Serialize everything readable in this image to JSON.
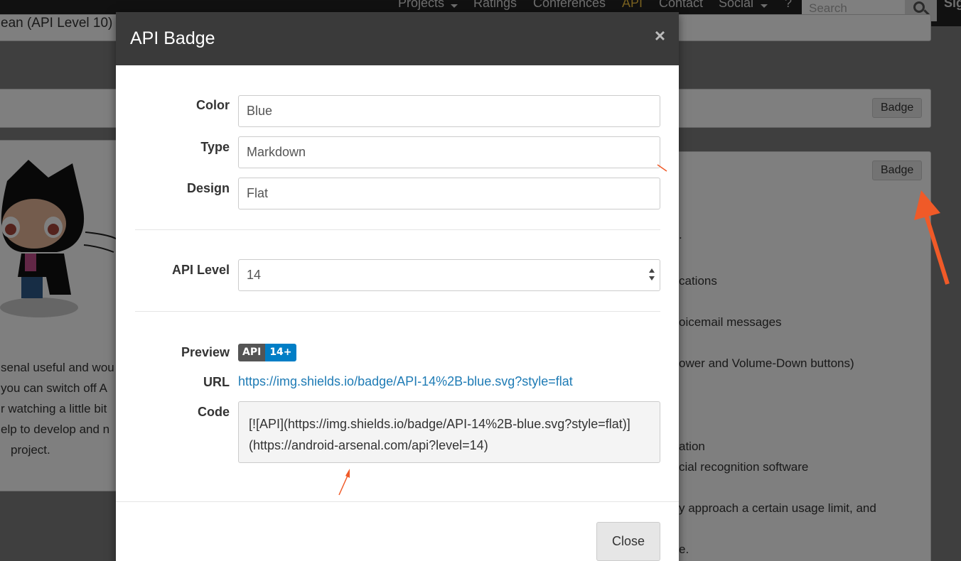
{
  "navbar": {
    "items": [
      {
        "label": "Projects",
        "has_caret": true
      },
      {
        "label": "Ratings",
        "has_caret": false
      },
      {
        "label": "Conferences",
        "has_caret": false
      },
      {
        "label": "API",
        "has_caret": false,
        "active": true
      },
      {
        "label": "Contact",
        "has_caret": false
      },
      {
        "label": "Social",
        "has_caret": true
      },
      {
        "label": "?",
        "has_caret": false
      }
    ],
    "search_placeholder": "Search",
    "sign_in_partial": "Sig"
  },
  "background": {
    "top_panel_text": "ean (API Level 10)",
    "badge_label": "Badge",
    "badge_label_2": "Badge",
    "left_lines": [
      "senal useful and wou",
      " you can switch off A",
      "r watching a little bit",
      "elp to develop and n",
      "project."
    ],
    "right_lines": [
      ".",
      "cations",
      "oicemail messages",
      "ower and Volume-Down buttons)",
      "ation",
      "cial recognition software",
      "y approach a certain usage limit, and",
      "e."
    ]
  },
  "modal": {
    "title": "API Badge",
    "close_symbol": "×",
    "fields": {
      "color": {
        "label": "Color",
        "value": "Blue"
      },
      "type": {
        "label": "Type",
        "value": "Markdown"
      },
      "design": {
        "label": "Design",
        "value": "Flat"
      },
      "api_level": {
        "label": "API Level",
        "value": "14"
      }
    },
    "preview": {
      "label": "Preview",
      "badge_left": "API",
      "badge_right": "14+"
    },
    "url": {
      "label": "URL",
      "value": "https://img.shields.io/badge/API-14%2B-blue.svg?style=flat"
    },
    "code": {
      "label": "Code",
      "line1": "[![API](https://img.shields.io/badge/API-14%2B-blue.svg?style=flat)]",
      "line2": "(https://android-arsenal.com/api?level=14)"
    },
    "close_button": "Close"
  },
  "colors": {
    "navbar_bg": "#222222",
    "nav_active": "#f0c040",
    "modal_header_bg": "#3a3a3a",
    "shield_left": "#555555",
    "shield_right": "#007ec6",
    "link": "#1e7bb5",
    "annotation_arrow": "#f05a28"
  }
}
